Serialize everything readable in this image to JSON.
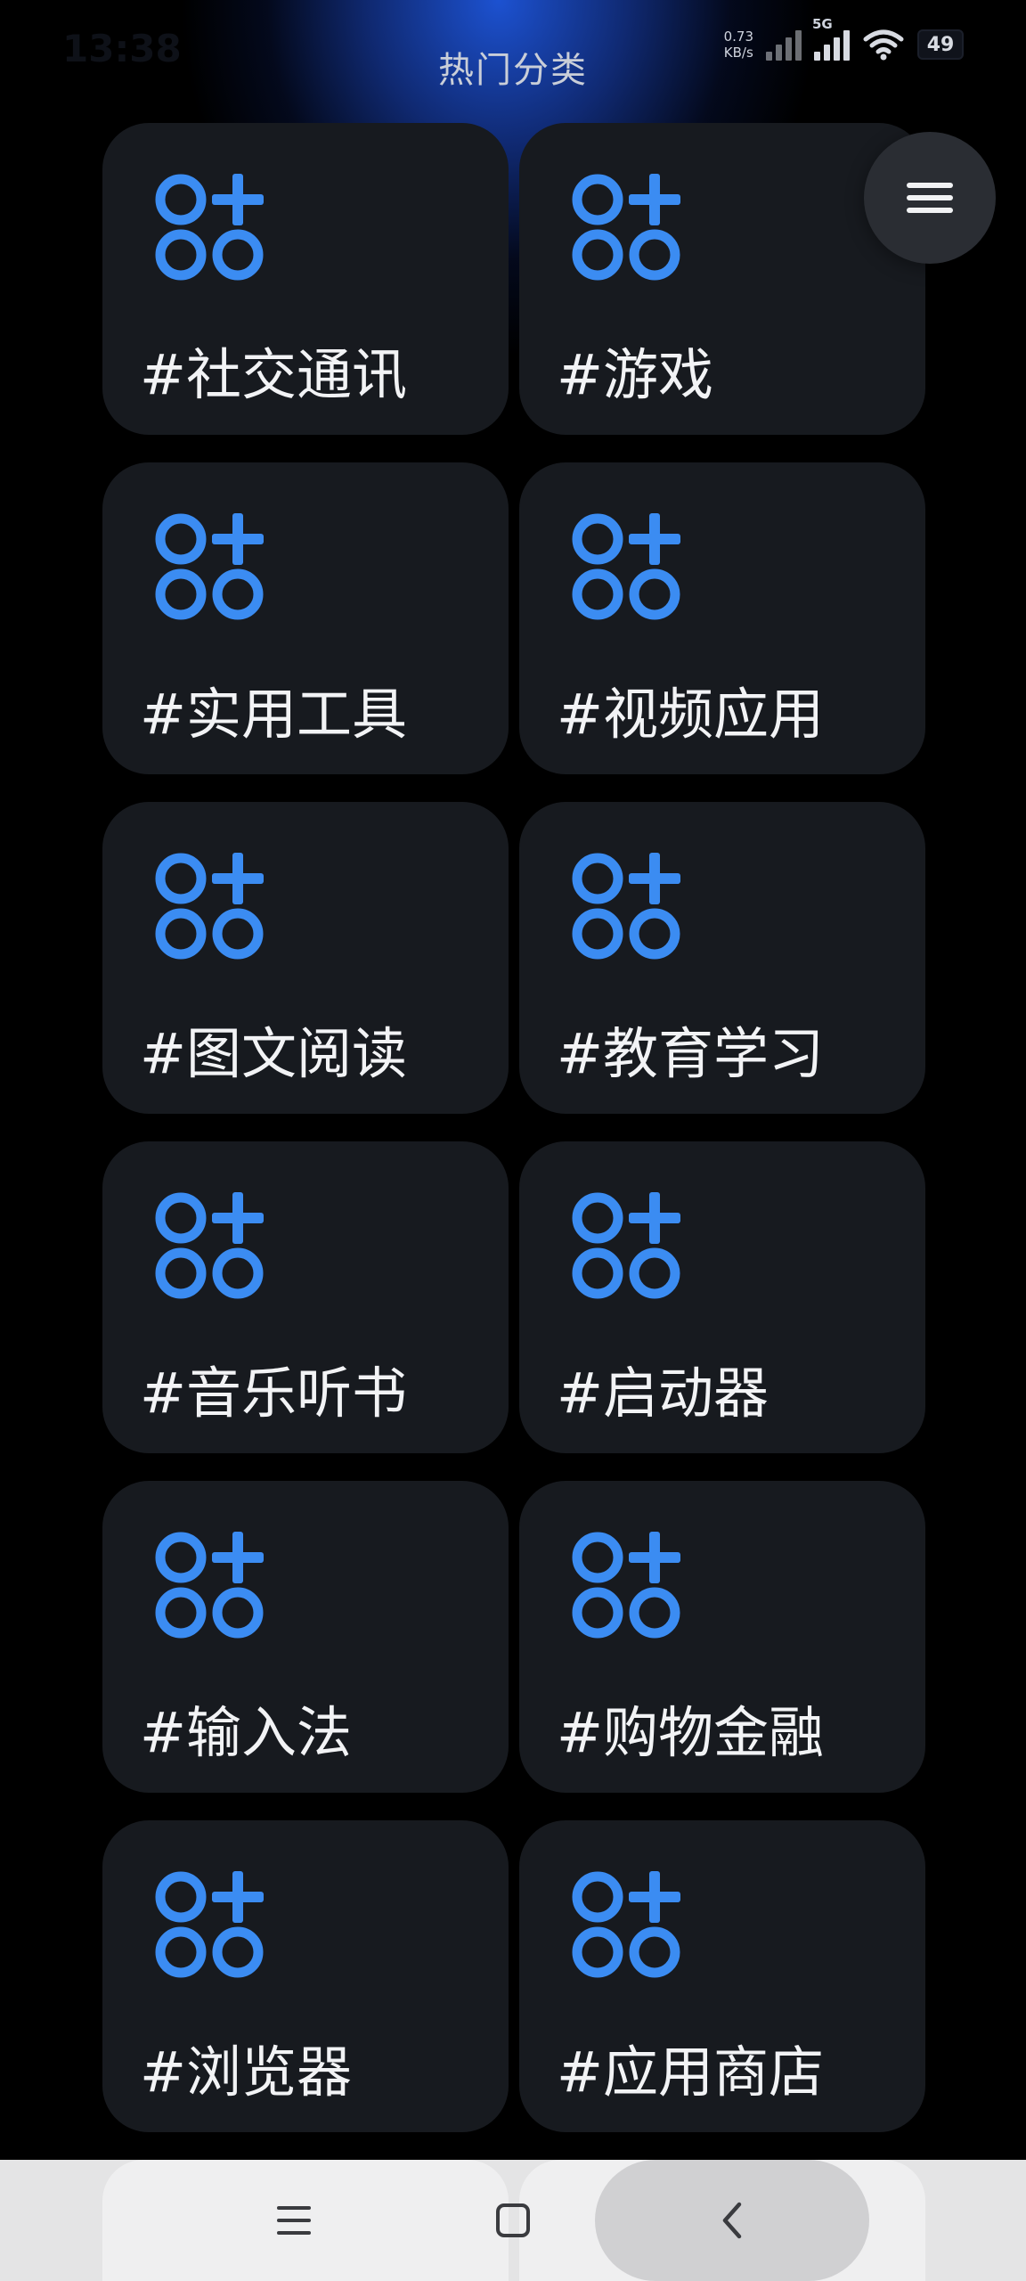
{
  "status_bar": {
    "time": "13:38",
    "net_speed_value": "0.73",
    "net_speed_unit": "KB/s",
    "network_type": "5G",
    "battery": "49"
  },
  "header": {
    "title": "热门分类"
  },
  "categories": [
    {
      "label": "#社交通讯",
      "icon": "apps-plus-icon"
    },
    {
      "label": "#游戏",
      "icon": "apps-plus-icon"
    },
    {
      "label": "#实用工具",
      "icon": "apps-plus-icon"
    },
    {
      "label": "#视频应用",
      "icon": "apps-plus-icon"
    },
    {
      "label": "#图文阅读",
      "icon": "apps-plus-icon"
    },
    {
      "label": "#教育学习",
      "icon": "apps-plus-icon"
    },
    {
      "label": "#音乐听书",
      "icon": "apps-plus-icon"
    },
    {
      "label": "#启动器",
      "icon": "apps-plus-icon"
    },
    {
      "label": "#输入法",
      "icon": "apps-plus-icon"
    },
    {
      "label": "#购物金融",
      "icon": "apps-plus-icon"
    },
    {
      "label": "#浏览器",
      "icon": "apps-plus-icon"
    },
    {
      "label": "#应用商店",
      "icon": "apps-plus-icon"
    }
  ],
  "menu_button": {
    "icon": "hamburger-menu-icon"
  },
  "nav_bar": {
    "items": [
      {
        "name": "recents",
        "icon": "menu-lines-icon"
      },
      {
        "name": "home",
        "icon": "square-home-icon"
      },
      {
        "name": "back",
        "icon": "chevron-left-icon"
      }
    ]
  },
  "colors": {
    "background": "#000000",
    "card": "#171a1f",
    "accent_icon": "#3b8cf2",
    "label": "#f2f3f5",
    "glow": "#1e56dc",
    "nav_bar": "#e4e4e5"
  }
}
